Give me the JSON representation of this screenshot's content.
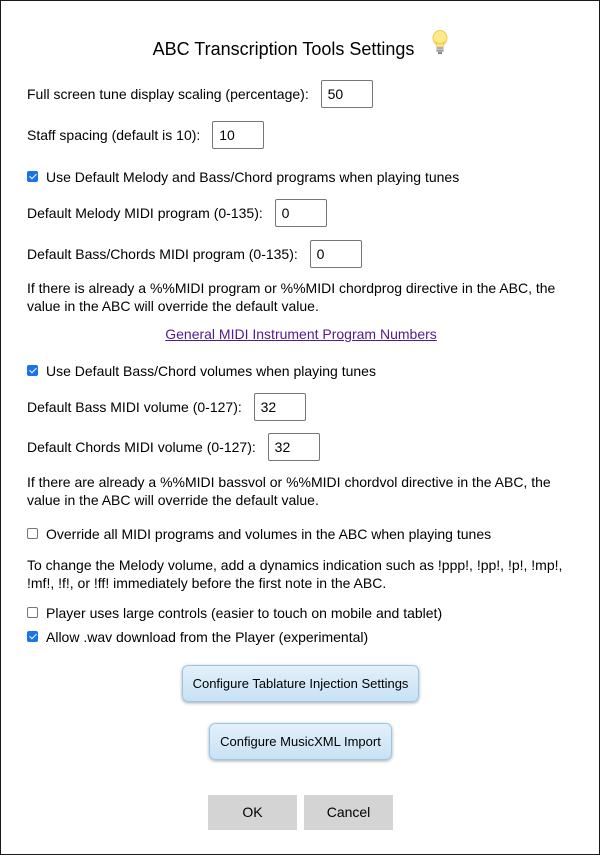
{
  "dialog": {
    "title": "ABC Transcription Tools Settings",
    "title_icon": "lightbulb-icon",
    "fullscreen_scaling": {
      "label": "Full screen tune display scaling (percentage):",
      "value": "50"
    },
    "staff_spacing": {
      "label": "Staff spacing (default is 10):",
      "value": "10"
    },
    "use_default_programs": {
      "label": "Use Default Melody and Bass/Chord programs when playing tunes",
      "checked": true
    },
    "melody_program": {
      "label": "Default Melody MIDI program (0-135):",
      "value": "0"
    },
    "bass_program": {
      "label": "Default Bass/Chords MIDI program (0-135):",
      "value": "0"
    },
    "program_note": "If there is already a %%MIDI program or %%MIDI chordprog directive in the ABC, the value in the ABC will override the default value.",
    "midi_link": "General MIDI Instrument Program Numbers",
    "use_default_volumes": {
      "label": "Use Default Bass/Chord volumes when playing tunes",
      "checked": true
    },
    "bass_volume": {
      "label": "Default Bass MIDI volume (0-127):",
      "value": "32"
    },
    "chords_volume": {
      "label": "Default Chords MIDI volume (0-127):",
      "value": "32"
    },
    "volume_note": "If there are already a %%MIDI bassvol or %%MIDI chordvol directive in the ABC, the value in the ABC will override the default value.",
    "override_all": {
      "label": "Override all MIDI programs and volumes in the ABC when playing tunes",
      "checked": false
    },
    "melody_volume_note": "To change the Melody volume, add a dynamics indication such as !ppp!, !pp!, !p!, !mp!, !mf!, !f!, or !ff! immediately before the first note in the ABC.",
    "large_controls": {
      "label": "Player uses large controls (easier to touch on mobile and tablet)",
      "checked": false
    },
    "allow_wav": {
      "label": "Allow .wav download from the Player (experimental)",
      "checked": true
    },
    "tablature_button": "Configure Tablature Injection Settings",
    "musicxml_button": "Configure MusicXML Import",
    "ok_button": "OK",
    "cancel_button": "Cancel"
  },
  "colors": {
    "checkbox_accent": "#1a73e8",
    "link": "#551a8b",
    "blue_button": "#c7e2f5",
    "gray_button": "#d4d4d4"
  }
}
